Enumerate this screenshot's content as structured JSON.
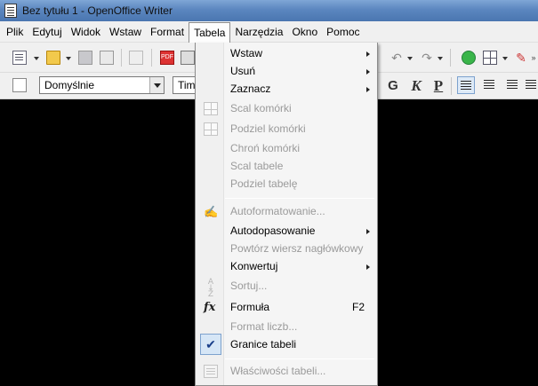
{
  "window": {
    "title": "Bez tytułu 1 - OpenOffice Writer"
  },
  "menubar": {
    "items": [
      {
        "label": "Plik",
        "active": false
      },
      {
        "label": "Edytuj",
        "active": false
      },
      {
        "label": "Widok",
        "active": false
      },
      {
        "label": "Wstaw",
        "active": false
      },
      {
        "label": "Format",
        "active": false
      },
      {
        "label": "Tabela",
        "active": true
      },
      {
        "label": "Narzędzia",
        "active": false
      },
      {
        "label": "Okno",
        "active": false
      },
      {
        "label": "Pomoc",
        "active": false
      }
    ]
  },
  "toolbar": {
    "style_combo_value": "Domyślnie",
    "font_combo_value": "Tim",
    "bold_label": "G",
    "italic_label": "K",
    "underline_label": "P"
  },
  "table_menu": {
    "items": [
      {
        "label": "Wstaw",
        "enabled": true,
        "submenu": true
      },
      {
        "label": "Usuń",
        "enabled": true,
        "submenu": true
      },
      {
        "label": "Zaznacz",
        "enabled": true,
        "submenu": true
      },
      {
        "label": "Scal komórki",
        "enabled": false,
        "icon": "merge-cells-icon"
      },
      {
        "label": "Podziel komórki",
        "enabled": false,
        "icon": "split-cells-icon"
      },
      {
        "label": "Chroń komórki",
        "enabled": false
      },
      {
        "label": "Scal tabele",
        "enabled": false
      },
      {
        "label": "Podziel tabelę",
        "enabled": false
      },
      {
        "label": "Autoformatowanie...",
        "enabled": false,
        "icon": "autoformat-icon"
      },
      {
        "label": "Autodopasowanie",
        "enabled": true,
        "submenu": true
      },
      {
        "label": "Powtórz wiersz nagłówkowy",
        "enabled": false
      },
      {
        "label": "Konwertuj",
        "enabled": true,
        "submenu": true
      },
      {
        "label": "Sortuj...",
        "enabled": false,
        "icon": "sort-icon"
      },
      {
        "label": "Formuła",
        "enabled": true,
        "icon": "formula-icon",
        "shortcut": "F2"
      },
      {
        "label": "Format liczb...",
        "enabled": false
      },
      {
        "label": "Granice tabeli",
        "enabled": true,
        "checked": true
      },
      {
        "label": "Właściwości tabeli...",
        "enabled": false,
        "icon": "table-properties-icon"
      }
    ]
  },
  "colors": {
    "titlebar": "#5b86bf",
    "menu_background": "#f5f5f5",
    "disabled_text": "#9a9a9a",
    "document_area": "#000000"
  }
}
